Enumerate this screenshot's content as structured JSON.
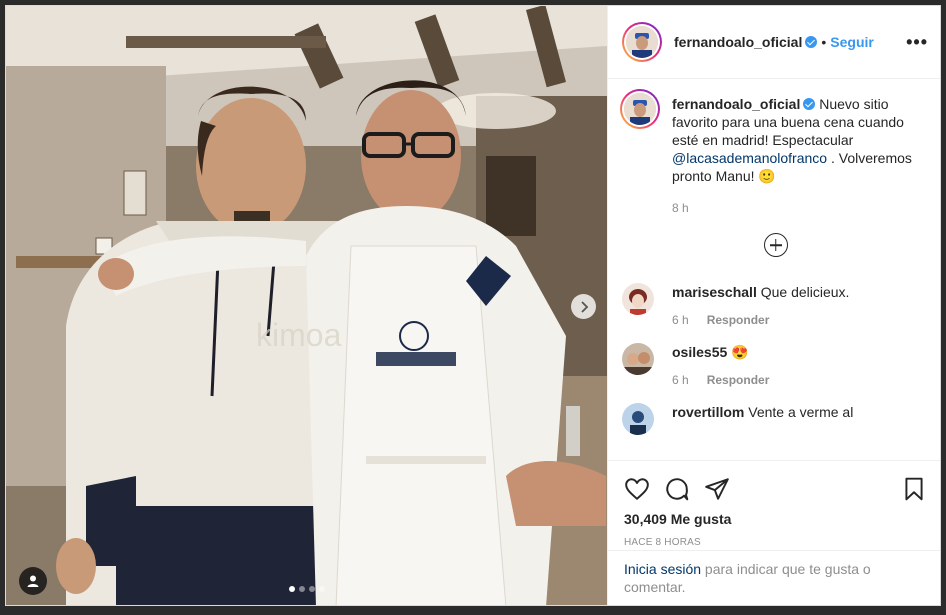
{
  "post": {
    "username": "fernandoalo_oficial",
    "follow_label": "Seguir",
    "separator": "•",
    "more_label": "•••",
    "carousel": {
      "slides": 4,
      "active": 1
    }
  },
  "caption": {
    "username": "fernandoalo_oficial",
    "text_1": " Nuevo sitio favorito para una buena cena cuando esté en madrid! Espectacular ",
    "mention": "@lacasademanolofranco",
    "text_2": " . Volveremos pronto Manu! 🙂",
    "time": "8 h"
  },
  "comments": [
    {
      "username": "mariseschall",
      "text": " Que delicieux.",
      "time": "6 h",
      "reply": "Responder"
    },
    {
      "username": "osiles55",
      "text": " 😍",
      "time": "6 h",
      "reply": "Responder"
    },
    {
      "username": "rovertillom",
      "text": " Vente a verme al",
      "time": "",
      "reply": ""
    }
  ],
  "stats": {
    "likes": "30,409 Me gusta",
    "time_ago": "HACE 8 HORAS"
  },
  "login_prompt": {
    "link": "Inicia sesión",
    "rest": " para indicar que te gusta o comentar."
  },
  "icons": [
    "user-tag-icon",
    "chevron-right-icon",
    "ellipsis-icon",
    "verified-icon",
    "add-comment-icon",
    "heart-icon",
    "comment-icon",
    "share-icon",
    "bookmark-icon"
  ],
  "colors": {
    "link": "#3897f0",
    "mention": "#00376b",
    "muted": "#8e8e8e",
    "text": "#262626"
  }
}
